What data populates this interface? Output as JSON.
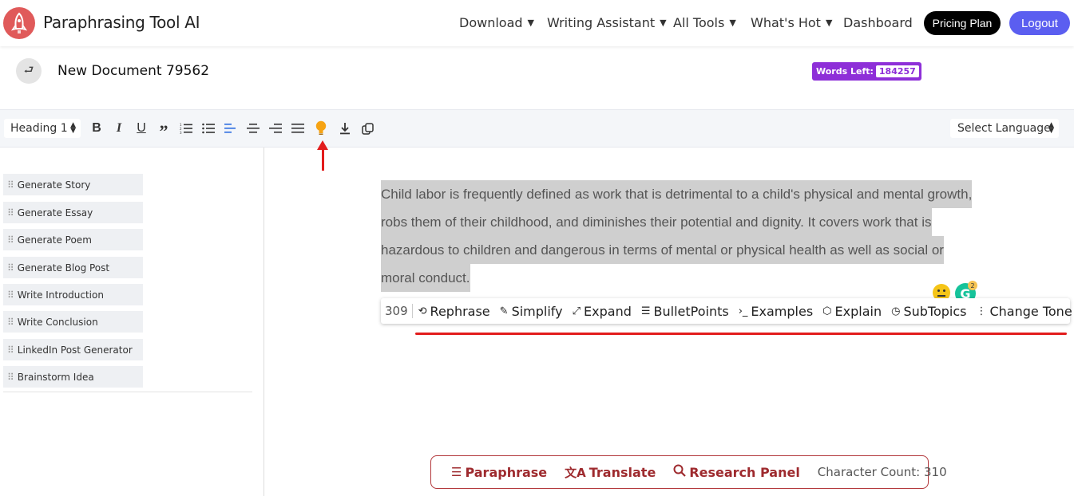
{
  "brand": "Paraphrasing Tool AI",
  "nav": [
    {
      "label": "Download",
      "has_caret": true
    },
    {
      "label": "Writing Assistant",
      "has_caret": true
    },
    {
      "label": "All Tools",
      "has_caret": true
    },
    {
      "label": "What's Hot",
      "has_caret": true
    },
    {
      "label": "Dashboard",
      "has_caret": false
    }
  ],
  "header_buttons": {
    "pricing": "Pricing Plan",
    "logout": "Logout"
  },
  "document": {
    "title": "New Document 79562"
  },
  "words_left": {
    "label": "Words Left:",
    "value": "184257"
  },
  "toolbar": {
    "heading_select": "Heading 1",
    "language_select": "Select Language",
    "icons": [
      "bold-icon",
      "italic-icon",
      "underline-icon",
      "quote-icon",
      "ordered-list-icon",
      "bullet-list-icon",
      "align-left-icon",
      "align-center-icon",
      "align-right-icon",
      "align-justify-icon",
      "lightbulb-icon",
      "download-icon",
      "copy-icon"
    ]
  },
  "sidebar": {
    "items": [
      {
        "label": "Generate Story"
      },
      {
        "label": "Generate Essay"
      },
      {
        "label": "Generate Poem"
      },
      {
        "label": "Generate Blog Post"
      },
      {
        "label": "Write Introduction"
      },
      {
        "label": "Write Conclusion"
      },
      {
        "label": "LinkedIn Post Generator"
      },
      {
        "label": "Brainstorm Idea"
      }
    ]
  },
  "editor": {
    "text": "Child labor is frequently defined as work that is detrimental to a child's physical and mental growth, robs them of their childhood, and diminishes their potential and dignity. It covers work that is hazardous to children and dangerous in terms of mental or physical health as well as social or moral conduct."
  },
  "grammarly_badge": "2",
  "ai_bar": {
    "count": "309",
    "actions": [
      {
        "label": "Rephrase",
        "icon": "rephrase-icon"
      },
      {
        "label": "Simplify",
        "icon": "pencil-icon"
      },
      {
        "label": "Expand",
        "icon": "expand-icon"
      },
      {
        "label": "BulletPoints",
        "icon": "list-icon"
      },
      {
        "label": "Examples",
        "icon": "terminal-icon"
      },
      {
        "label": "Explain",
        "icon": "cube-icon"
      },
      {
        "label": "SubTopics",
        "icon": "clock-icon"
      },
      {
        "label": "Change Tone",
        "icon": "kebab-icon"
      }
    ]
  },
  "bottom_panel": {
    "paraphrase": "Paraphrase",
    "translate": "Translate",
    "research": "Research Panel",
    "char_count": "Character Count: 310"
  },
  "colors": {
    "accent_purple": "#8e2fd8",
    "logout": "#5b5ef0",
    "annotation_red": "#e21c1c",
    "bottom_panel": "#9e2a2e"
  }
}
